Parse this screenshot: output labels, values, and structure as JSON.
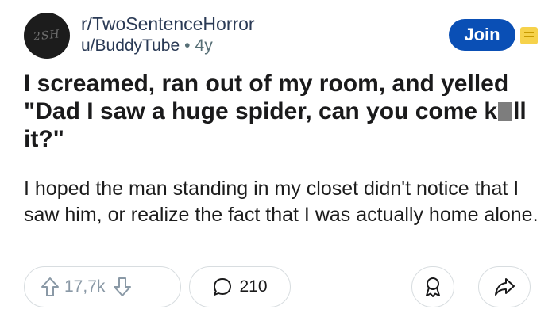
{
  "post": {
    "subreddit": "r/TwoSentenceHorror",
    "author": "u/BuddyTube",
    "separator": "•",
    "age": "4y",
    "avatar_text": "2SH",
    "join_label": "Join",
    "title_part1": "I screamed, ran out of my room, and yelled \"Dad I saw a huge spider, can you come k",
    "title_part2": "ll it?\"",
    "body": "I hoped the man standing in my closet didn't notice that I saw him, or realize the fact that I was actually home alone."
  },
  "actions": {
    "vote_count": "17,7k",
    "comment_count": "210"
  },
  "icons": {
    "upvote": "arrow-up-icon",
    "downvote": "arrow-down-icon",
    "comment": "speech-bubble-icon",
    "save": "award-icon",
    "share": "share-arrow-icon",
    "more": "menu-lines-icon"
  },
  "colors": {
    "join_button": "#0a4fb5",
    "more_icon": "#f6d24b",
    "text": "#1a1a1b",
    "muted": "#576f76"
  }
}
